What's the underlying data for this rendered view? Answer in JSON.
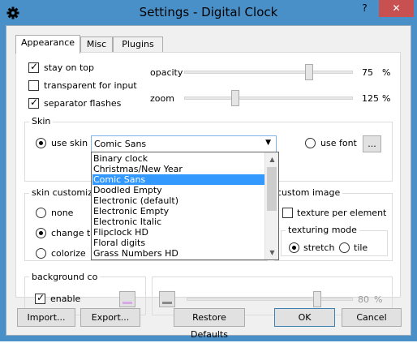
{
  "window": {
    "title": "Settings - Digital Clock",
    "help_label": "?",
    "close_label": "✕",
    "icon": "gear-icon"
  },
  "tabs": [
    {
      "label": "Appearance",
      "active": true
    },
    {
      "label": "Misc",
      "active": false
    },
    {
      "label": "Plugins",
      "active": false
    }
  ],
  "general": {
    "stay_on_top": {
      "label": "stay on top",
      "checked": true
    },
    "transparent_for_input": {
      "label": "transparent for input",
      "checked": false
    },
    "separator_flashes": {
      "label": "separator flashes",
      "checked": true
    },
    "opacity": {
      "label": "opacity",
      "value": "75",
      "unit": "%",
      "fraction": 0.75
    },
    "zoom": {
      "label": "zoom",
      "value": "125",
      "unit": "%",
      "fraction": 0.3
    }
  },
  "skin": {
    "group_title": "Skin",
    "use_skin_label": "use skin",
    "use_skin_selected": true,
    "selected_skin": "Comic Sans",
    "use_font_label": "use font",
    "use_font_selected": false,
    "font_button_label": "...",
    "dropdown_items": [
      "Binary clock",
      "Christmas/New Year",
      "Comic Sans",
      "Doodled Empty",
      "Electronic (default)",
      "Electronic Empty",
      "Electronic Italic",
      "Flipclock HD",
      "Floral digits",
      "Grass Numbers HD"
    ],
    "dropdown_selected_index": 2
  },
  "customization": {
    "group_title": "skin customiza",
    "none_label": "none",
    "change_label": "change te",
    "colorize_label": "colorize",
    "selected": "change",
    "custom_image_title": "custom image",
    "texture_per_element_label": "texture per element",
    "texture_per_element_checked": false,
    "texturing_mode_title": "texturing mode",
    "stretch_label": "stretch",
    "tile_label": "tile",
    "texturing_mode_selected": "stretch"
  },
  "background": {
    "group_title": "background co",
    "enable_label": "enable",
    "enable_checked": true,
    "value": "80",
    "unit": "%",
    "fraction": 0.8
  },
  "buttons": {
    "import": "Import...",
    "export": "Export...",
    "restore": "Restore Defaults",
    "ok": "OK",
    "cancel": "Cancel"
  },
  "colors": {
    "titlebar": "#4a90c8",
    "close": "#c75050",
    "selection": "#3399ff"
  }
}
